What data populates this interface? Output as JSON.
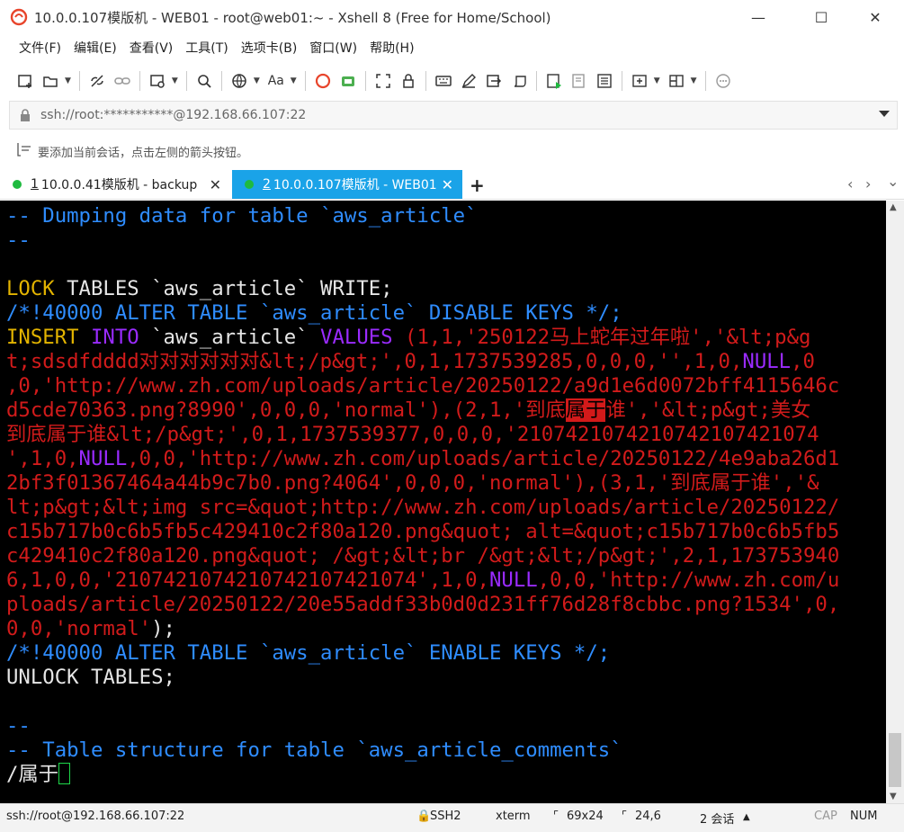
{
  "window": {
    "title": "10.0.0.107模版机 - WEB01 - root@web01:~ - Xshell 8 (Free for Home/School)",
    "minimize": "—",
    "maximize": "☐",
    "close": "✕"
  },
  "menu": [
    "文件(F)",
    "编辑(E)",
    "查看(V)",
    "工具(T)",
    "选项卡(B)",
    "窗口(W)",
    "帮助(H)"
  ],
  "toolbar": {
    "font_label": "Aa"
  },
  "address": {
    "value": "ssh://root:***********@192.168.66.107:22"
  },
  "hint": {
    "text": "要添加当前会话，点击左侧的箭头按钮。"
  },
  "tabs": [
    {
      "number": "1",
      "label": "10.0.0.41模版机 - backup",
      "close": "✕"
    },
    {
      "number": "2",
      "label": "10.0.0.107模版机 - WEB01",
      "close": "✕"
    }
  ],
  "tab_add": "+",
  "tab_nav": {
    "left": "‹",
    "right": "›",
    "menu": "⌄"
  },
  "terminal": {
    "lines": [
      [
        {
          "t": "-- Dumping data for table `aws_article`",
          "c": "blue"
        }
      ],
      [
        {
          "t": "--",
          "c": "blue"
        }
      ],
      [
        {
          "t": "",
          "c": "white"
        }
      ],
      [
        {
          "t": "LOCK",
          "c": "yellow"
        },
        {
          "t": " TABLES `aws_article` WRITE;",
          "c": "white"
        }
      ],
      [
        {
          "t": "/*!40000 ALTER TABLE `aws_article` DISABLE KEYS */;",
          "c": "blue"
        }
      ],
      [
        {
          "t": "INSERT",
          "c": "yellow"
        },
        {
          "t": " ",
          "c": "white"
        },
        {
          "t": "INTO",
          "c": "purple"
        },
        {
          "t": " `aws_article` ",
          "c": "white"
        },
        {
          "t": "VALUES",
          "c": "purple"
        },
        {
          "t": " (1,1,'250122马上蛇年过年啦','&lt;p&g",
          "c": "red"
        }
      ],
      [
        {
          "t": "t;sdsdfdddd对对对对对对&lt;/p&gt;',0,1,1737539285,0,0,0,'',1,0,",
          "c": "red"
        },
        {
          "t": "NULL",
          "c": "purple"
        },
        {
          "t": ",0",
          "c": "red"
        }
      ],
      [
        {
          "t": ",0,'http://www.zh.com/uploads/article/20250122/a9d1e6d0072bff4115646c",
          "c": "red"
        }
      ],
      [
        {
          "t": "d5cde70363.png?8990',0,0,0,'normal'),(2,1,'到底",
          "c": "red"
        },
        {
          "t": "属于",
          "c": "hl"
        },
        {
          "t": "谁','&lt;p&gt;美女",
          "c": "red"
        }
      ],
      [
        {
          "t": "到底属于谁&lt;/p&gt;',0,1,1737539377,0,0,0,'2107421074210742107421074",
          "c": "red"
        }
      ],
      [
        {
          "t": "',1,0,",
          "c": "red"
        },
        {
          "t": "NULL",
          "c": "purple"
        },
        {
          "t": ",0,0,'http://www.zh.com/uploads/article/20250122/4e9aba26d1",
          "c": "red"
        }
      ],
      [
        {
          "t": "2bf3f01367464a44b9c7b0.png?4064',0,0,0,'normal'),(3,1,'到底属于谁','&",
          "c": "red"
        }
      ],
      [
        {
          "t": "lt;p&gt;&lt;img src=&quot;http://www.zh.com/uploads/article/20250122/",
          "c": "red"
        }
      ],
      [
        {
          "t": "c15b717b0c6b5fb5c429410c2f80a120.png&quot; alt=&quot;c15b717b0c6b5fb5",
          "c": "red"
        }
      ],
      [
        {
          "t": "c429410c2f80a120.png&quot; /&gt;&lt;br /&gt;&lt;/p&gt;',2,1,173753940",
          "c": "red"
        }
      ],
      [
        {
          "t": "6,1,0,0,'2107421074210742107421074',1,0,",
          "c": "red"
        },
        {
          "t": "NULL",
          "c": "purple"
        },
        {
          "t": ",0,0,'http://www.zh.com/u",
          "c": "red"
        }
      ],
      [
        {
          "t": "ploads/article/20250122/20e55addf33b0d0d231ff76d28f8cbbc.png?1534',0,",
          "c": "red"
        }
      ],
      [
        {
          "t": "0,0,'normal'",
          "c": "red"
        },
        {
          "t": ");",
          "c": "white"
        }
      ],
      [
        {
          "t": "/*!40000 ALTER TABLE `aws_article` ENABLE KEYS */;",
          "c": "blue"
        }
      ],
      [
        {
          "t": "UNLOCK TABLES;",
          "c": "white"
        }
      ],
      [
        {
          "t": "",
          "c": "white"
        }
      ],
      [
        {
          "t": "--",
          "c": "blue"
        }
      ],
      [
        {
          "t": "-- Table structure for table `aws_article_comments`",
          "c": "blue"
        }
      ],
      [
        {
          "t": "/属于",
          "c": "white"
        }
      ]
    ]
  },
  "status": {
    "connection": "ssh://root@192.168.66.107:22",
    "protocol": "SSH2",
    "term": "xterm",
    "size": "69x24",
    "cursor_pos": "24,6",
    "sessions": "2 会话",
    "caps": "CAP",
    "num": "NUM"
  }
}
